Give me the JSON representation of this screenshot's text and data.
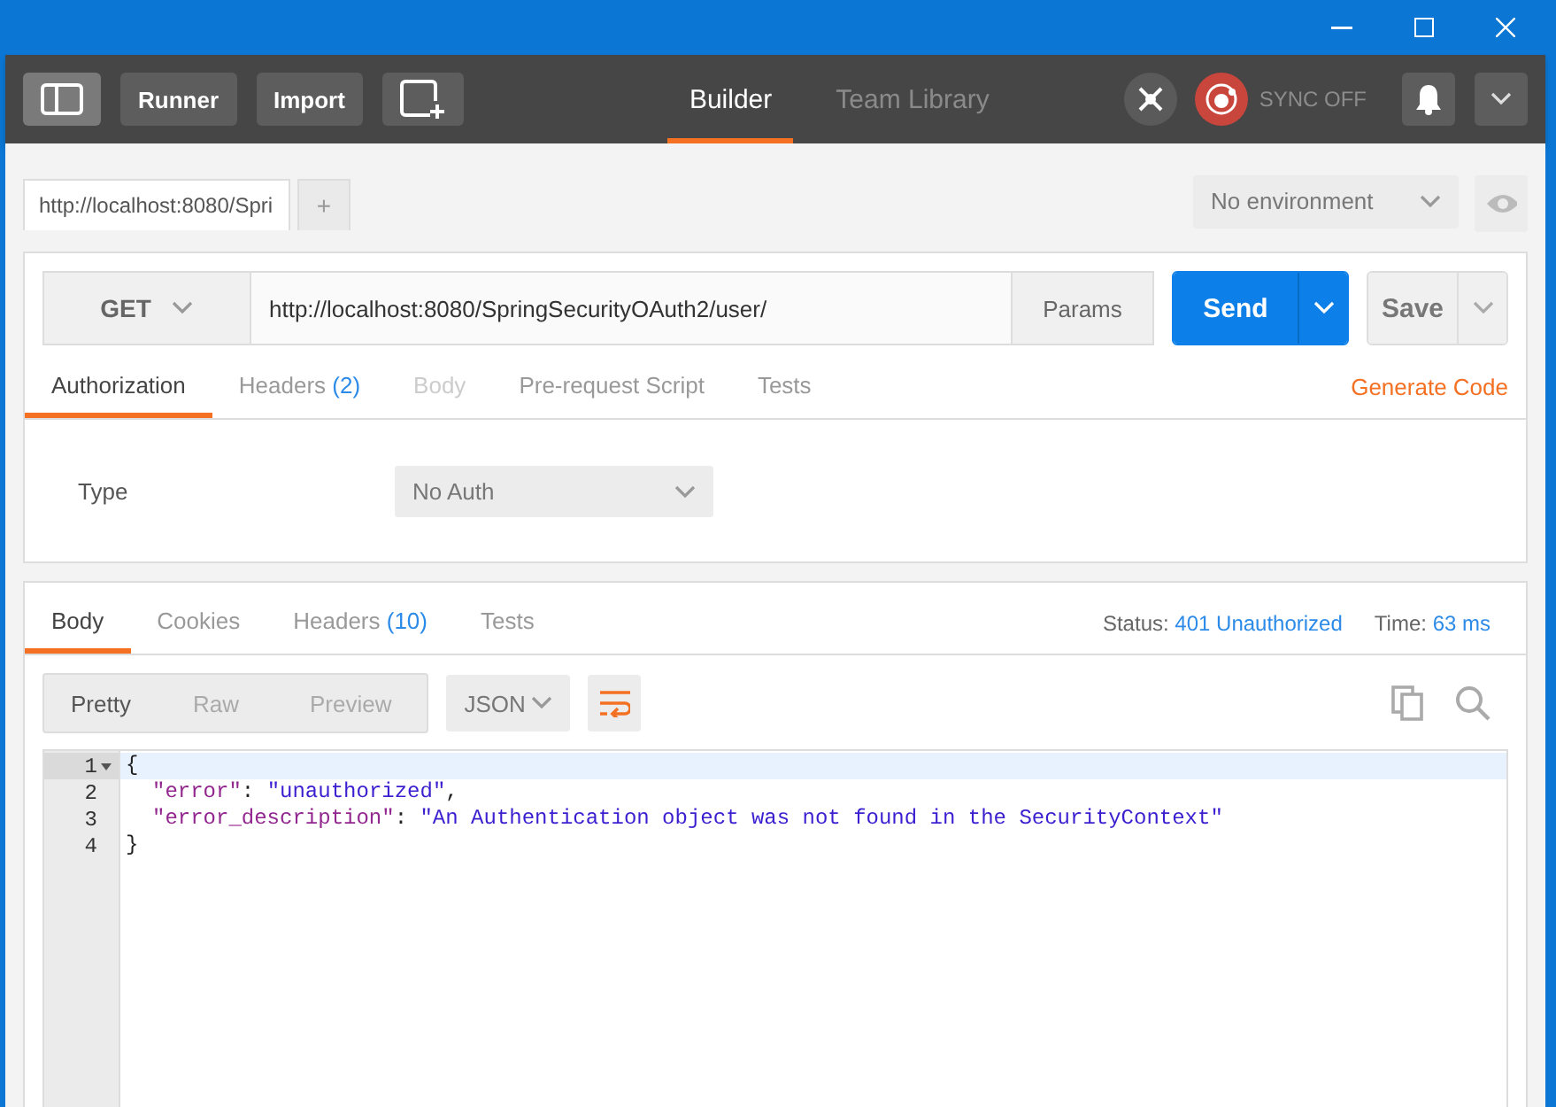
{
  "toolbar": {
    "buttons": [
      "Runner",
      "Import"
    ],
    "tabs": [
      {
        "label": "Builder",
        "selected": true
      },
      {
        "label": "Team Library",
        "selected": false
      }
    ],
    "sync": {
      "label": "SYNC OFF",
      "on": false
    }
  },
  "request_tabs": [
    {
      "label": "http://localhost:8080/Spri",
      "selected": true
    }
  ],
  "add_tab": "+",
  "environment": {
    "value": "No environment"
  },
  "request": {
    "method": "GET",
    "url": "http://localhost:8080/SpringSecurityOAuth2/user/",
    "params": "Params",
    "send": "Send",
    "save": "Save"
  },
  "request_subtabs": [
    {
      "label": "Authorization",
      "selected": true,
      "disabled": false
    },
    {
      "label": "Headers",
      "count": "(2)",
      "selected": false,
      "disabled": false
    },
    {
      "label": "Body",
      "selected": false,
      "disabled": true
    },
    {
      "label": "Pre-request Script",
      "selected": false,
      "disabled": false
    },
    {
      "label": "Tests",
      "selected": false,
      "disabled": false
    }
  ],
  "generate_code": "Generate Code",
  "auth": {
    "label": "Type",
    "value": "No Auth"
  },
  "response_tabs": [
    {
      "label": "Body",
      "selected": true
    },
    {
      "label": "Cookies",
      "selected": false
    },
    {
      "label": "Headers",
      "count": "(10)",
      "selected": false
    },
    {
      "label": "Tests",
      "selected": false
    }
  ],
  "status": {
    "label": "Status:",
    "value": "401 Unauthorized"
  },
  "time": {
    "label": "Time:",
    "value": "63 ms"
  },
  "view_modes": [
    {
      "label": "Pretty",
      "selected": true
    },
    {
      "label": "Raw",
      "selected": false
    },
    {
      "label": "Preview",
      "selected": false
    }
  ],
  "format": "JSON",
  "code_lines": [
    {
      "number": "1",
      "active": true,
      "foldable": true,
      "indented": false,
      "tokens": [
        {
          "kind": "punct",
          "text": "{"
        }
      ]
    },
    {
      "number": "2",
      "active": false,
      "foldable": false,
      "indented": true,
      "tokens": [
        {
          "kind": "key",
          "text": "\"error\""
        },
        {
          "kind": "punct",
          "text": ": "
        },
        {
          "kind": "string",
          "text": "\"unauthorized\""
        },
        {
          "kind": "punct",
          "text": ","
        }
      ]
    },
    {
      "number": "3",
      "active": false,
      "foldable": false,
      "indented": true,
      "tokens": [
        {
          "kind": "key",
          "text": "\"error_description\""
        },
        {
          "kind": "punct",
          "text": ": "
        },
        {
          "kind": "string",
          "text": "\"An Authentication object was not found in the SecurityContext\""
        }
      ]
    },
    {
      "number": "4",
      "active": false,
      "foldable": false,
      "indented": false,
      "tokens": [
        {
          "kind": "punct",
          "text": "}"
        }
      ]
    }
  ]
}
